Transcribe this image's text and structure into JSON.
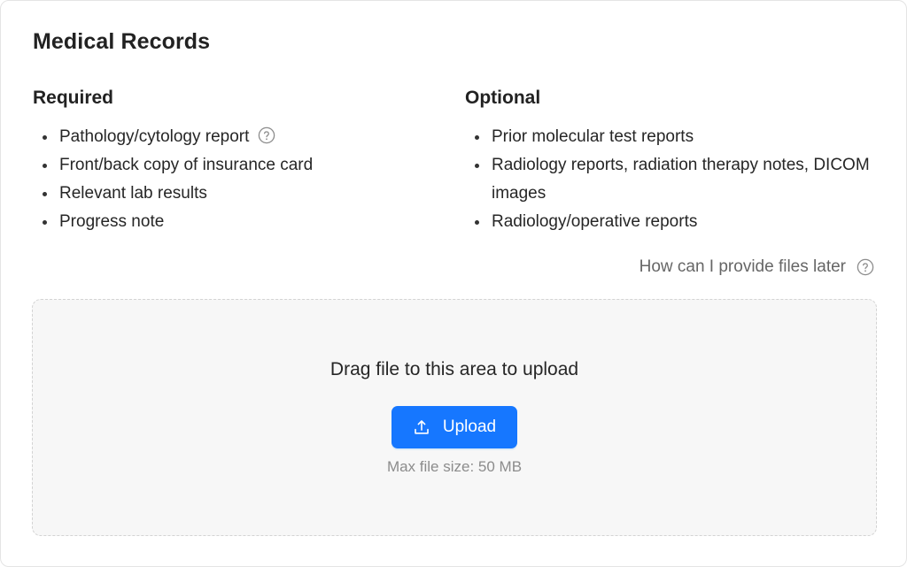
{
  "title": "Medical Records",
  "required": {
    "heading": "Required",
    "items": [
      "Pathology/cytology report",
      "Front/back copy of insurance card",
      "Relevant lab results",
      "Progress note"
    ]
  },
  "optional": {
    "heading": "Optional",
    "items": [
      "Prior molecular test reports",
      "Radiology reports, radiation therapy notes, DICOM images",
      "Radiology/operative reports"
    ]
  },
  "help_link": "How can I provide files later",
  "dropzone": {
    "text": "Drag file to this area to upload",
    "button_label": "Upload",
    "max_size": "Max file size: 50 MB"
  },
  "icons": {
    "help": "question-circle-icon",
    "upload": "upload-icon"
  },
  "colors": {
    "primary": "#1677ff",
    "muted_text": "#8c8c8c",
    "dropzone_bg": "#f7f7f7"
  }
}
